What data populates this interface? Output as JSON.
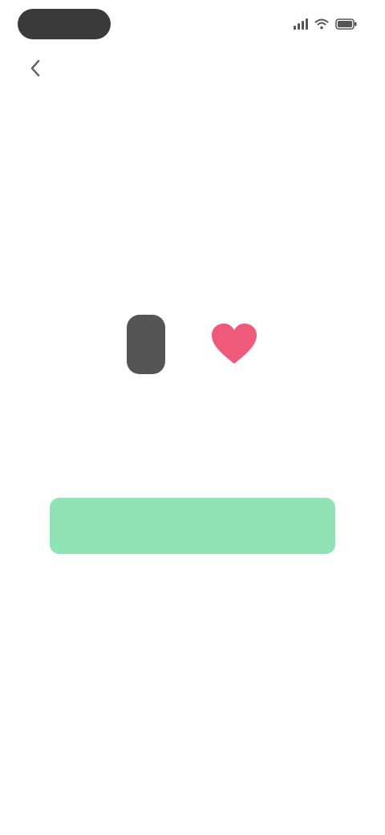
{
  "status_bar": {
    "time": "",
    "icons": [
      "signal-icon",
      "wifi-icon",
      "battery-icon"
    ]
  },
  "header": {
    "title": "",
    "back_icon": "chevron-left-icon"
  },
  "main": {
    "heading": "",
    "description": "",
    "illustration": [
      "phone-icon",
      "heart-icon"
    ],
    "primary_button_label": ""
  },
  "colors": {
    "accent_green": "#8fe3b4",
    "heart_pink": "#ef5a7a",
    "text_dark": "#3d3d3d",
    "text_muted": "#888888"
  }
}
